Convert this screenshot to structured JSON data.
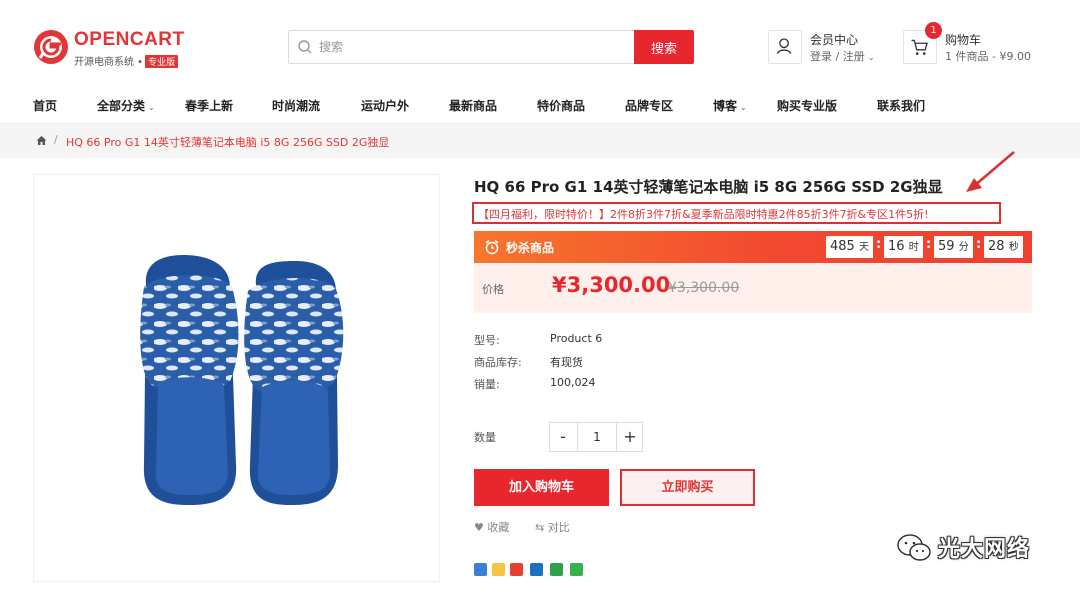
{
  "logo": {
    "brand": "OPENCART",
    "subtitle": "开源电商系统 •",
    "badge": "专业版"
  },
  "search": {
    "placeholder": "搜索",
    "button_label": "搜索"
  },
  "account": {
    "title": "会员中心",
    "links": "登录 / 注册"
  },
  "cart": {
    "count": "1",
    "title": "购物车",
    "summary": "1 件商品 - ¥9.00"
  },
  "nav": {
    "items": [
      "首页",
      "全部分类",
      "春季上新",
      "时尚潮流",
      "运动户外",
      "最新商品",
      "特价商品",
      "品牌专区",
      "博客",
      "购买专业版",
      "联系我们"
    ]
  },
  "breadcrumb": {
    "current": "HQ 66 Pro G1 14英寸轻薄笔记本电脑 i5 8G 256G SSD 2G独显"
  },
  "product": {
    "title": "HQ 66 Pro G1 14英寸轻薄笔记本电脑 i5 8G 256G SSD 2G独显",
    "promo": "【四月福利，限时特价！】2件8折3件7折&夏季新品限时特惠2件85折3件7折&专区1件5折!",
    "flash": {
      "label": "秒杀商品",
      "days": "485",
      "days_unit": "天",
      "hours": "16",
      "hours_unit": "时",
      "minutes": "59",
      "minutes_unit": "分",
      "seconds": "28",
      "seconds_unit": "秒"
    },
    "price_label": "价格",
    "price_now": "¥3,300.00",
    "price_old": "¥3,300.00",
    "specs": [
      {
        "key": "型号:",
        "value": "Product 6"
      },
      {
        "key": "商品库存:",
        "value": "有现货"
      },
      {
        "key": "销量:",
        "value": "100,024"
      }
    ],
    "quantity_label": "数量",
    "quantity": "1",
    "add_to_cart": "加入购物车",
    "buy_now": "立即购买",
    "wishlist": "收藏",
    "compare": "对比"
  },
  "watermark": "光大网络",
  "colors": {
    "accent": "#e8262e",
    "flash_start": "#f7762c",
    "flash_end": "#ef3f2f",
    "price_bg": "#fff0ec"
  }
}
